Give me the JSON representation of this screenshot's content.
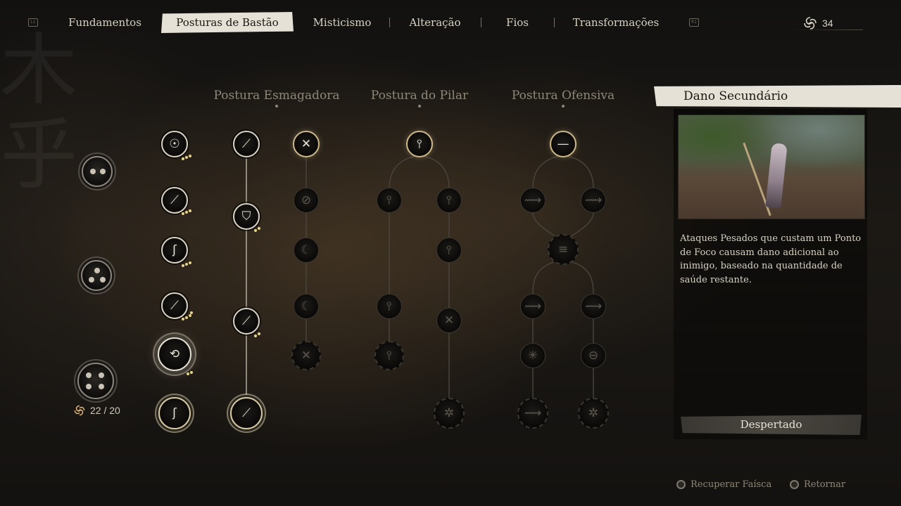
{
  "nav": {
    "left_bumper": "L1",
    "right_bumper": "R1",
    "tabs": [
      {
        "label": "Fundamentos"
      },
      {
        "label": "Posturas de Bastão",
        "active": true
      },
      {
        "label": "Misticismo"
      },
      {
        "label": "Alteração"
      },
      {
        "label": "Fios"
      },
      {
        "label": "Transformações"
      }
    ],
    "currency": {
      "icon": "spark-swirl-icon",
      "value": "34"
    }
  },
  "stances": [
    "Postura Esmagadora",
    "Postura do Pilar",
    "Postura Ofensiva"
  ],
  "sparks": {
    "icon": "spark-swirl-icon",
    "value": "22 / 20"
  },
  "detail": {
    "title": "Dano Secundário",
    "description": "Ataques Pesados que custam um Ponto de Foco causam dano adicional ao inimigo, baseado na quantidade de saúde restante.",
    "button": "Despertado"
  },
  "footer": {
    "recover": "Recuperar Faísca",
    "back": "Retornar"
  },
  "colors": {
    "accent": "#e6e1d6",
    "pip_gold": "#e7d58a",
    "ring_gold": "#cdb98a"
  }
}
